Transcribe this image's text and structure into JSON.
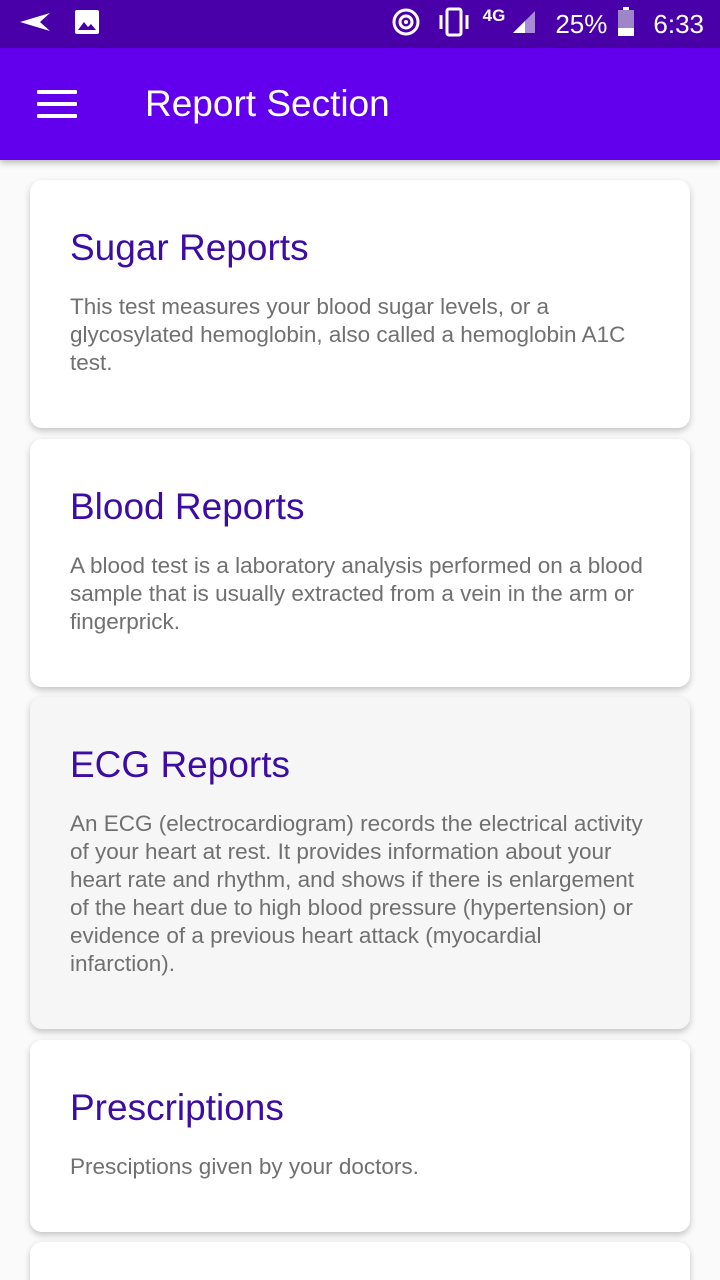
{
  "status_bar": {
    "network": "4G",
    "battery": "25%",
    "time": "6:33"
  },
  "app_bar": {
    "title": "Report Section"
  },
  "cards": [
    {
      "title": "Sugar Reports",
      "description": "This test measures your blood sugar levels, or a glycosylated hemoglobin, also called a hemoglobin A1C test."
    },
    {
      "title": "Blood Reports",
      "description": "A blood test is a laboratory analysis performed on a blood sample that is usually extracted from a vein in the arm or fingerprick."
    },
    {
      "title": "ECG Reports",
      "description": "An ECG (electrocardiogram) records the electrical activity of your heart at rest. It provides information about your heart rate and rhythm, and shows if there is enlargement of the heart due to high blood pressure (hypertension) or evidence of a previous heart attack (myocardial infarction)."
    },
    {
      "title": "Prescriptions",
      "description": "Presciptions given by your doctors."
    }
  ],
  "colors": {
    "status_bar": "#4a00a8",
    "app_bar": "#6200ee",
    "card_title": "#3c0ca3",
    "card_text": "#707070"
  }
}
